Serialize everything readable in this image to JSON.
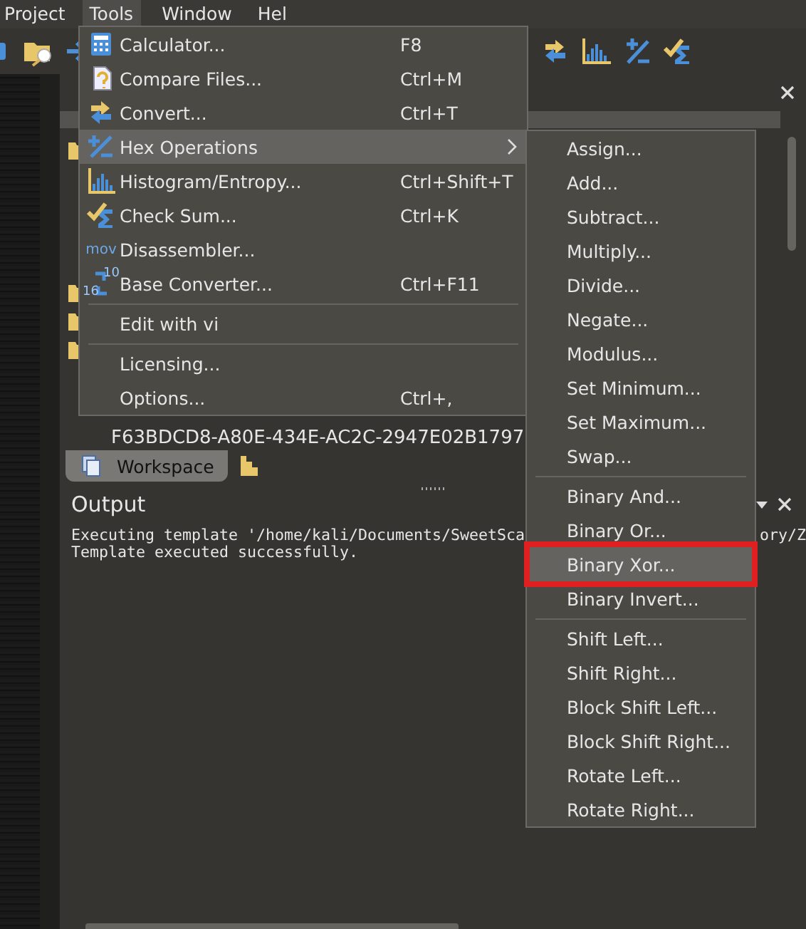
{
  "menubar": [
    {
      "label": "Project",
      "selected": false
    },
    {
      "label": "Tools",
      "selected": true
    },
    {
      "label": "Window",
      "selected": false
    },
    {
      "label": "Hel",
      "selected": false
    }
  ],
  "workspace_panel": {
    "guid": "F63BDCD8-A80E-434E-AC2C-2947E02B1797",
    "tabs": [
      {
        "label": "Workspace",
        "selected": true
      },
      {
        "selected": false
      }
    ]
  },
  "output_panel": {
    "title": "Output",
    "lines": [
      {
        "parts": [
          "Executing template '/home/kali/Documents/SweetSca",
          "ory/Z"
        ]
      },
      {
        "parts": [
          "Template executed successfully."
        ]
      }
    ]
  },
  "tools_menu": {
    "items": [
      {
        "kind": "item",
        "label": "Calculator...",
        "shortcut": "F8",
        "selected": false
      },
      {
        "kind": "item",
        "label": "Compare Files...",
        "shortcut": "Ctrl+M",
        "selected": false
      },
      {
        "kind": "item",
        "label": "Convert...",
        "shortcut": "Ctrl+T",
        "selected": false
      },
      {
        "kind": "submenu",
        "label": "Hex Operations",
        "selected": true
      },
      {
        "kind": "item",
        "label": "Histogram/Entropy...",
        "shortcut": "Ctrl+Shift+T",
        "selected": false
      },
      {
        "kind": "item",
        "label": "Check Sum...",
        "shortcut": "Ctrl+K",
        "selected": false
      },
      {
        "kind": "item",
        "label": "Disassembler...",
        "icon_text": "mov",
        "selected": false
      },
      {
        "kind": "item",
        "label": "Base Converter...",
        "shortcut": "Ctrl+F11",
        "icon_labels": [
          "10",
          "16"
        ],
        "selected": false
      },
      {
        "kind": "separator"
      },
      {
        "kind": "item",
        "label": "Edit with vi",
        "selected": false
      },
      {
        "kind": "separator"
      },
      {
        "kind": "item",
        "label": "Licensing...",
        "selected": false
      },
      {
        "kind": "item",
        "label": "Options...",
        "shortcut": "Ctrl+,",
        "selected": false
      }
    ]
  },
  "hex_operations_menu": {
    "items": [
      {
        "kind": "item",
        "label": "Assign...",
        "selected": false,
        "outlined": false
      },
      {
        "kind": "item",
        "label": "Add...",
        "selected": false,
        "outlined": false
      },
      {
        "kind": "item",
        "label": "Subtract...",
        "selected": false,
        "outlined": false
      },
      {
        "kind": "item",
        "label": "Multiply...",
        "selected": false,
        "outlined": false
      },
      {
        "kind": "item",
        "label": "Divide...",
        "selected": false,
        "outlined": false
      },
      {
        "kind": "item",
        "label": "Negate...",
        "selected": false,
        "outlined": false
      },
      {
        "kind": "item",
        "label": "Modulus...",
        "selected": false,
        "outlined": false
      },
      {
        "kind": "item",
        "label": "Set Minimum...",
        "selected": false,
        "outlined": false
      },
      {
        "kind": "item",
        "label": "Set Maximum...",
        "selected": false,
        "outlined": false
      },
      {
        "kind": "item",
        "label": "Swap...",
        "selected": false,
        "outlined": false
      },
      {
        "kind": "separator"
      },
      {
        "kind": "item",
        "label": "Binary And...",
        "selected": false,
        "outlined": false
      },
      {
        "kind": "item",
        "label": "Binary Or...",
        "selected": false,
        "outlined": false
      },
      {
        "kind": "item",
        "label": "Binary Xor...",
        "selected": true,
        "outlined": true
      },
      {
        "kind": "item",
        "label": "Binary Invert...",
        "selected": false,
        "outlined": false
      },
      {
        "kind": "separator"
      },
      {
        "kind": "item",
        "label": "Shift Left...",
        "selected": false,
        "outlined": false
      },
      {
        "kind": "item",
        "label": "Shift Right...",
        "selected": false,
        "outlined": false
      },
      {
        "kind": "item",
        "label": "Block Shift Left...",
        "selected": false,
        "outlined": false
      },
      {
        "kind": "item",
        "label": "Block Shift Right...",
        "selected": false,
        "outlined": false
      },
      {
        "kind": "item",
        "label": "Rotate Left...",
        "selected": false,
        "outlined": false
      },
      {
        "kind": "item",
        "label": "Rotate Right...",
        "selected": false,
        "outlined": false
      }
    ]
  }
}
